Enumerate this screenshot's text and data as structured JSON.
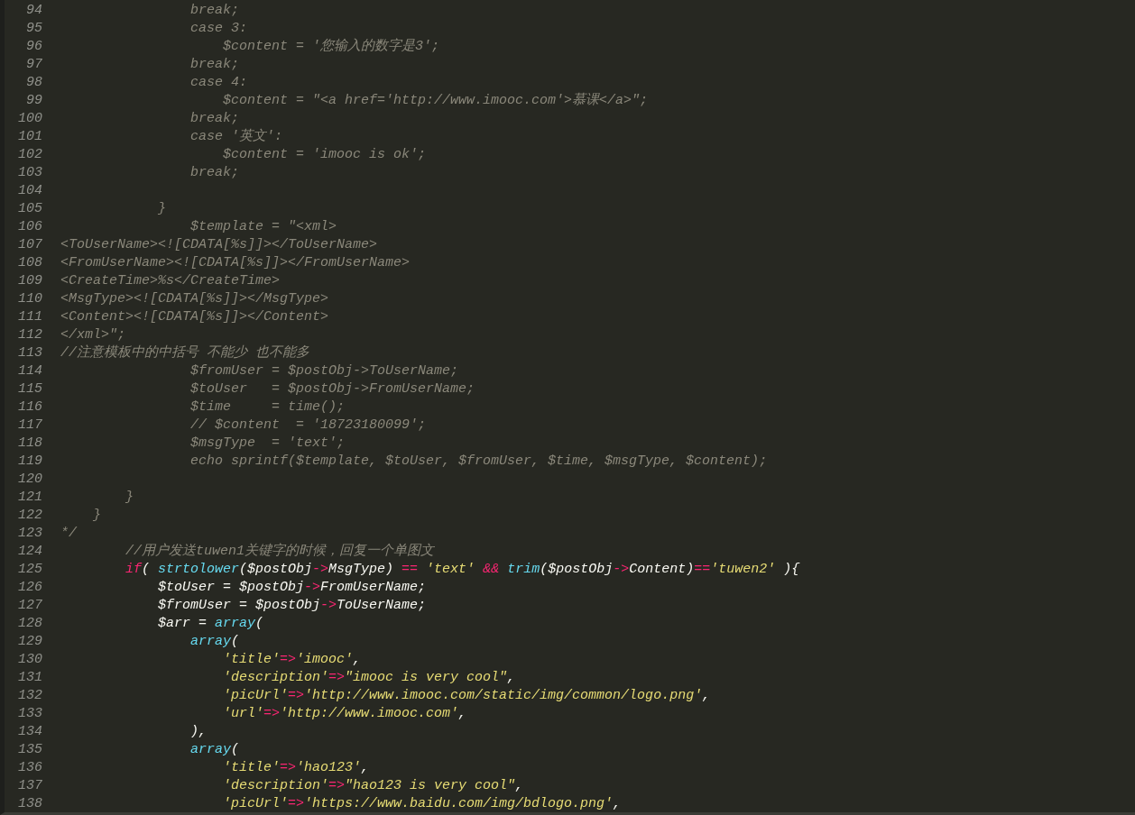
{
  "editor": {
    "lines": [
      {
        "number": "94",
        "tokens": [
          {
            "kind": "comment",
            "text": "                break;"
          }
        ]
      },
      {
        "number": "95",
        "tokens": [
          {
            "kind": "comment",
            "text": "                case 3:"
          }
        ]
      },
      {
        "number": "96",
        "tokens": [
          {
            "kind": "comment",
            "text": "                    $content = '您输入的数字是3';"
          }
        ]
      },
      {
        "number": "97",
        "tokens": [
          {
            "kind": "comment",
            "text": "                break;"
          }
        ]
      },
      {
        "number": "98",
        "tokens": [
          {
            "kind": "comment",
            "text": "                case 4:"
          }
        ]
      },
      {
        "number": "99",
        "tokens": [
          {
            "kind": "comment",
            "text": "                    $content = \"<a href='http://www.imooc.com'>慕课</a>\";"
          }
        ]
      },
      {
        "number": "100",
        "tokens": [
          {
            "kind": "comment",
            "text": "                break;"
          }
        ]
      },
      {
        "number": "101",
        "tokens": [
          {
            "kind": "comment",
            "text": "                case '英文':"
          }
        ]
      },
      {
        "number": "102",
        "tokens": [
          {
            "kind": "comment",
            "text": "                    $content = 'imooc is ok';"
          }
        ]
      },
      {
        "number": "103",
        "tokens": [
          {
            "kind": "comment",
            "text": "                break;"
          }
        ]
      },
      {
        "number": "104"
      },
      {
        "number": "105",
        "tokens": [
          {
            "kind": "comment",
            "text": "            }"
          }
        ]
      },
      {
        "number": "106",
        "tokens": [
          {
            "kind": "comment",
            "text": "                $template = \"<xml>"
          }
        ]
      },
      {
        "number": "107",
        "tokens": [
          {
            "kind": "comment",
            "text": "<ToUserName><![CDATA[%s]]></ToUserName>"
          }
        ]
      },
      {
        "number": "108",
        "tokens": [
          {
            "kind": "comment",
            "text": "<FromUserName><![CDATA[%s]]></FromUserName>"
          }
        ]
      },
      {
        "number": "109",
        "tokens": [
          {
            "kind": "comment",
            "text": "<CreateTime>%s</CreateTime>"
          }
        ]
      },
      {
        "number": "110",
        "tokens": [
          {
            "kind": "comment",
            "text": "<MsgType><![CDATA[%s]]></MsgType>"
          }
        ]
      },
      {
        "number": "111",
        "tokens": [
          {
            "kind": "comment",
            "text": "<Content><![CDATA[%s]]></Content>"
          }
        ]
      },
      {
        "number": "112",
        "tokens": [
          {
            "kind": "comment",
            "text": "</xml>\";"
          }
        ]
      },
      {
        "number": "113",
        "tokens": [
          {
            "kind": "comment",
            "text": "//注意模板中的中括号 不能少 也不能多"
          }
        ]
      },
      {
        "number": "114",
        "tokens": [
          {
            "kind": "comment",
            "text": "                $fromUser = $postObj->ToUserName;"
          }
        ]
      },
      {
        "number": "115",
        "tokens": [
          {
            "kind": "comment",
            "text": "                $toUser   = $postObj->FromUserName;"
          }
        ]
      },
      {
        "number": "116",
        "tokens": [
          {
            "kind": "comment",
            "text": "                $time     = time();"
          }
        ]
      },
      {
        "number": "117",
        "tokens": [
          {
            "kind": "comment",
            "text": "                // $content  = '18723180099';"
          }
        ]
      },
      {
        "number": "118",
        "tokens": [
          {
            "kind": "comment",
            "text": "                $msgType  = 'text';"
          }
        ]
      },
      {
        "number": "119",
        "tokens": [
          {
            "kind": "comment",
            "text": "                echo sprintf($template, $toUser, $fromUser, $time, $msgType, $content);"
          }
        ]
      },
      {
        "number": "120"
      },
      {
        "number": "121",
        "tokens": [
          {
            "kind": "comment",
            "text": "        }"
          }
        ]
      },
      {
        "number": "122",
        "tokens": [
          {
            "kind": "comment",
            "text": "    }"
          }
        ]
      },
      {
        "number": "123",
        "tokens": [
          {
            "kind": "comment",
            "text": "*/"
          }
        ]
      },
      {
        "number": "124",
        "tokens": [
          {
            "kind": "comment",
            "text": "        //用户发送tuwen1关键字的时候，回复一个单图文"
          }
        ]
      },
      {
        "number": "125",
        "tokens": [
          {
            "kind": "keyword",
            "text": "        if"
          },
          {
            "kind": "plain",
            "text": "( "
          },
          {
            "kind": "function",
            "text": "strtolower"
          },
          {
            "kind": "plain",
            "text": "($postObj"
          },
          {
            "kind": "operator",
            "text": "->"
          },
          {
            "kind": "plain",
            "text": "MsgType)"
          },
          {
            "kind": "operator",
            "text": " == "
          },
          {
            "kind": "string",
            "text": "'text'"
          },
          {
            "kind": "operator",
            "text": " && "
          },
          {
            "kind": "function",
            "text": "trim"
          },
          {
            "kind": "plain",
            "text": "($postObj"
          },
          {
            "kind": "operator",
            "text": "->"
          },
          {
            "kind": "plain",
            "text": "Content)"
          },
          {
            "kind": "operator",
            "text": "=="
          },
          {
            "kind": "string",
            "text": "'tuwen2'"
          },
          {
            "kind": "plain",
            "text": " ){"
          }
        ]
      },
      {
        "number": "126",
        "tokens": [
          {
            "kind": "plain",
            "text": "            $toUser = $postObj"
          },
          {
            "kind": "operator",
            "text": "->"
          },
          {
            "kind": "plain",
            "text": "FromUserName;"
          }
        ]
      },
      {
        "number": "127",
        "tokens": [
          {
            "kind": "plain",
            "text": "            $fromUser = $postObj"
          },
          {
            "kind": "operator",
            "text": "->"
          },
          {
            "kind": "plain",
            "text": "ToUserName;"
          }
        ]
      },
      {
        "number": "128",
        "tokens": [
          {
            "kind": "plain",
            "text": "            $arr = "
          },
          {
            "kind": "function",
            "text": "array"
          },
          {
            "kind": "plain",
            "text": "("
          }
        ]
      },
      {
        "number": "129",
        "tokens": [
          {
            "kind": "function",
            "text": "                array"
          },
          {
            "kind": "plain",
            "text": "("
          }
        ]
      },
      {
        "number": "130",
        "tokens": [
          {
            "kind": "string",
            "text": "                    'title'"
          },
          {
            "kind": "operator",
            "text": "=>"
          },
          {
            "kind": "string",
            "text": "'imooc'"
          },
          {
            "kind": "plain",
            "text": ","
          }
        ]
      },
      {
        "number": "131",
        "tokens": [
          {
            "kind": "string",
            "text": "                    'description'"
          },
          {
            "kind": "operator",
            "text": "=>"
          },
          {
            "kind": "string",
            "text": "\"imooc is very cool\""
          },
          {
            "kind": "plain",
            "text": ","
          }
        ]
      },
      {
        "number": "132",
        "tokens": [
          {
            "kind": "string",
            "text": "                    'picUrl'"
          },
          {
            "kind": "operator",
            "text": "=>"
          },
          {
            "kind": "string",
            "text": "'http://www.imooc.com/static/img/common/logo.png'"
          },
          {
            "kind": "plain",
            "text": ","
          }
        ]
      },
      {
        "number": "133",
        "tokens": [
          {
            "kind": "string",
            "text": "                    'url'"
          },
          {
            "kind": "operator",
            "text": "=>"
          },
          {
            "kind": "string",
            "text": "'http://www.imooc.com'"
          },
          {
            "kind": "plain",
            "text": ","
          }
        ]
      },
      {
        "number": "134",
        "tokens": [
          {
            "kind": "plain",
            "text": "                ),"
          }
        ]
      },
      {
        "number": "135",
        "tokens": [
          {
            "kind": "function",
            "text": "                array"
          },
          {
            "kind": "plain",
            "text": "("
          }
        ]
      },
      {
        "number": "136",
        "tokens": [
          {
            "kind": "string",
            "text": "                    'title'"
          },
          {
            "kind": "operator",
            "text": "=>"
          },
          {
            "kind": "string",
            "text": "'hao123'"
          },
          {
            "kind": "plain",
            "text": ","
          }
        ]
      },
      {
        "number": "137",
        "tokens": [
          {
            "kind": "string",
            "text": "                    'description'"
          },
          {
            "kind": "operator",
            "text": "=>"
          },
          {
            "kind": "string",
            "text": "\"hao123 is very cool\""
          },
          {
            "kind": "plain",
            "text": ","
          }
        ]
      },
      {
        "number": "138",
        "tokens": [
          {
            "kind": "string",
            "text": "                    'picUrl'"
          },
          {
            "kind": "operator",
            "text": "=>"
          },
          {
            "kind": "string",
            "text": "'https://www.baidu.com/img/bdlogo.png'"
          },
          {
            "kind": "plain",
            "text": ","
          }
        ]
      }
    ]
  }
}
